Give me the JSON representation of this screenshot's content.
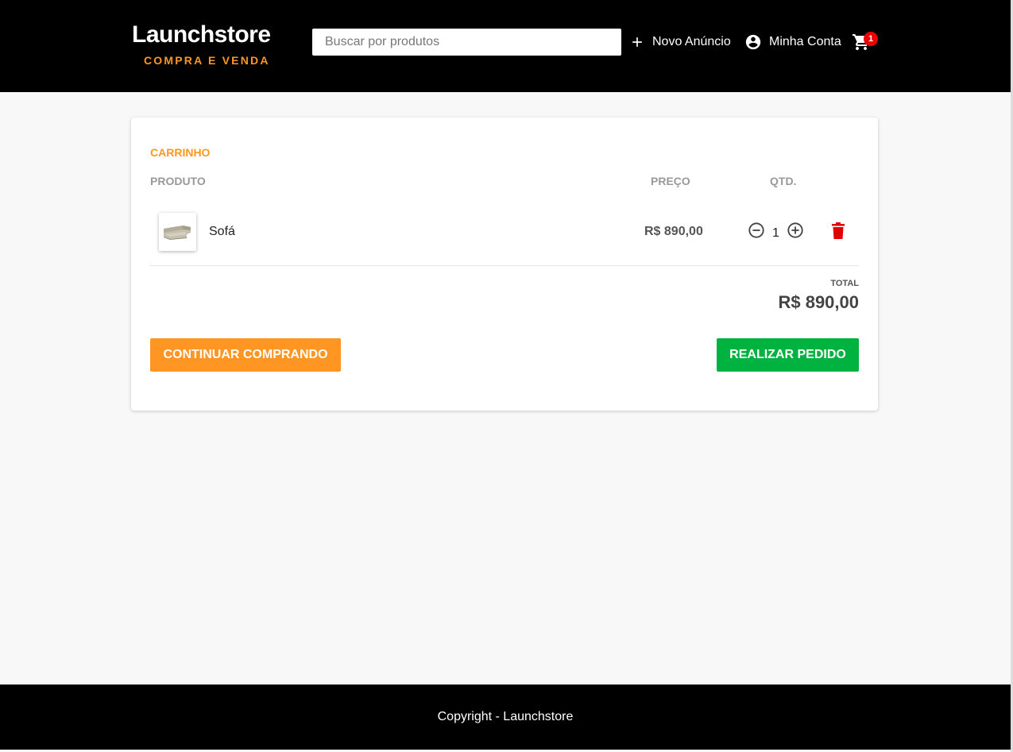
{
  "header": {
    "logo_title": "Launchstore",
    "logo_subtitle": "COMPRA E VENDA",
    "search_placeholder": "Buscar por produtos",
    "new_ad_label": "Novo Anúncio",
    "account_label": "Minha Conta",
    "cart_count": "1"
  },
  "cart": {
    "title": "CARRINHO",
    "columns": {
      "product": "PRODUTO",
      "price": "PREÇO",
      "qty": "QTD."
    },
    "items": [
      {
        "name": "Sofá",
        "price": "R$ 890,00",
        "quantity": "1"
      }
    ],
    "total_label": "TOTAL",
    "total_value": "R$ 890,00",
    "continue_label": "CONTINUAR COMPRANDO",
    "order_label": "REALIZAR PEDIDO"
  },
  "footer": {
    "text": "Copyright - Launchstore"
  },
  "colors": {
    "brand_orange": "#ff9623",
    "success_green": "#00b341",
    "danger_red": "#e00000",
    "header_bg": "#000000"
  },
  "icons": {
    "new_ad": "plus-icon",
    "account": "account-circle-icon",
    "cart": "shopping-cart-icon",
    "qty_decrease": "minus-circle-icon",
    "qty_increase": "plus-circle-icon",
    "remove": "trash-icon"
  }
}
